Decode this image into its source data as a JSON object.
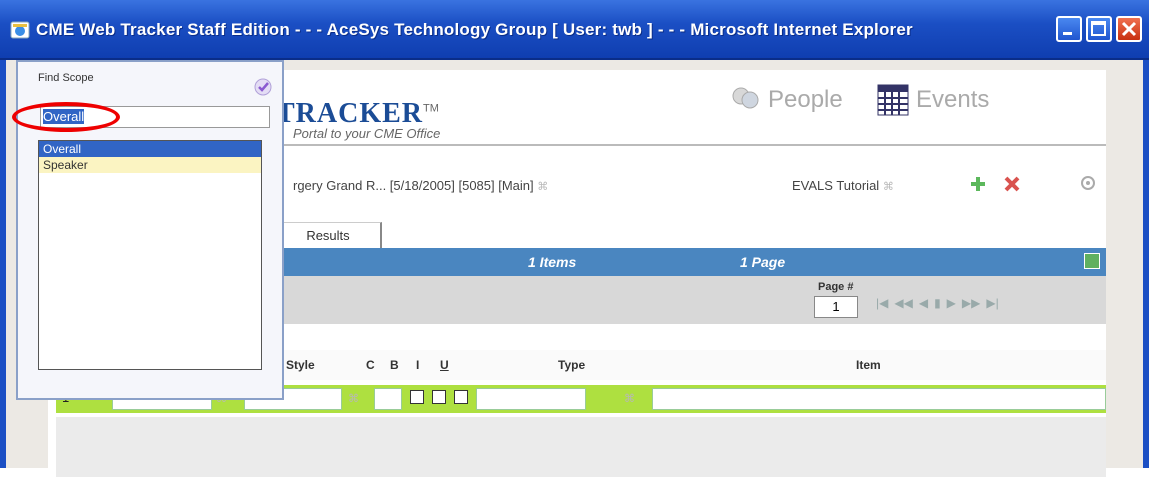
{
  "window": {
    "title": "CME Web Tracker Staff Edition - - - AceSys Technology Group [ User: twb ] - - - Microsoft Internet Explorer"
  },
  "header": {
    "logo": "TRACKER",
    "logo_tm": "TM",
    "tagline": "Portal to your CME Office",
    "nav": {
      "people": "People",
      "events": "Events"
    }
  },
  "record": {
    "breadcrumb": "rgery Grand R... [5/18/2005] [5085] [Main]",
    "evals_label": "EVALS Tutorial"
  },
  "tabs": {
    "results": "Results"
  },
  "summary": {
    "items": "1 Items",
    "pages": "1 Page"
  },
  "pager": {
    "label": "Page #",
    "value": "1"
  },
  "grid": {
    "columns": {
      "style": "Style",
      "c": "C",
      "b": "B",
      "i": "I",
      "u": "U",
      "type": "Type",
      "item": "Item"
    },
    "rows": [
      {
        "num": "1"
      }
    ]
  },
  "popup": {
    "title": "Find Scope",
    "input_value": "Overall",
    "options": [
      "Overall",
      "Speaker"
    ],
    "selected_index": 0
  },
  "colors": {
    "titlebar": "#1b4fc4",
    "accent_green": "#aee040",
    "bar_blue": "#4a86c0",
    "annotation": "#e00000"
  }
}
